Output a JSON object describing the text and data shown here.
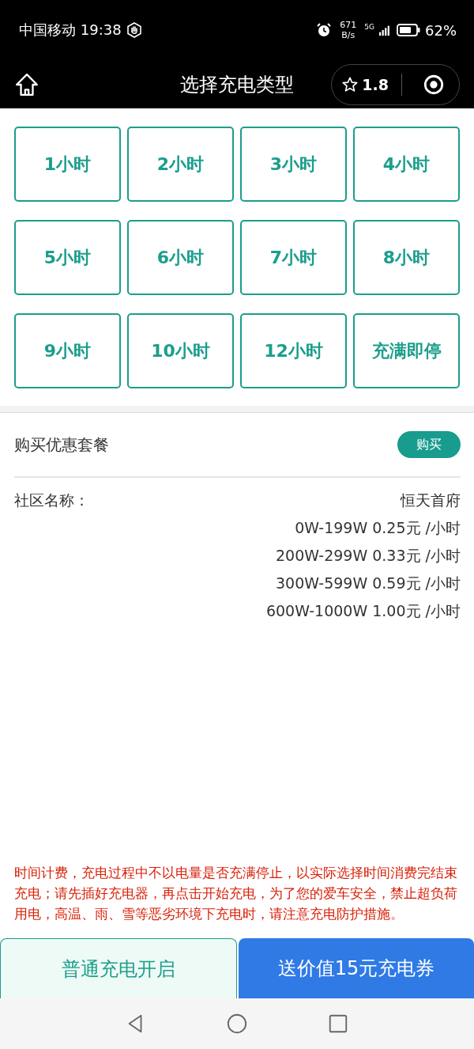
{
  "status_bar": {
    "carrier_time": "中国移动 19:38",
    "speed_value": "671",
    "speed_unit": "B/s",
    "network": "5G",
    "battery": "62%"
  },
  "header": {
    "title": "选择充电类型",
    "rating": "1.8"
  },
  "options": [
    {
      "label": "1小时",
      "selected": false
    },
    {
      "label": "2小时",
      "selected": false
    },
    {
      "label": "3小时",
      "selected": false
    },
    {
      "label": "4小时",
      "selected": false
    },
    {
      "label": "5小时",
      "selected": false
    },
    {
      "label": "6小时",
      "selected": false
    },
    {
      "label": "7小时",
      "selected": false
    },
    {
      "label": "8小时",
      "selected": false
    },
    {
      "label": "9小时",
      "selected": false
    },
    {
      "label": "10小时",
      "selected": false
    },
    {
      "label": "12小时",
      "selected": false
    },
    {
      "label": "充满即停",
      "selected": false
    }
  ],
  "package": {
    "label": "购买优惠套餐",
    "button": "购买"
  },
  "community": {
    "label": "社区名称：",
    "name": "恒天首府",
    "prices": [
      "0W-199W 0.25元 /小时",
      "200W-299W 0.33元 /小时",
      "300W-599W 0.59元 /小时",
      "600W-1000W 1.00元 /小时"
    ]
  },
  "notice": "时间计费，充电过程中不以电量是否充满停止，以实际选择时间消费完结束充电；请先插好充电器，再点击开始充电，为了您的爱车安全，禁止超负荷用电，高温、雨、雪等恶劣环境下充电时，请注意充电防护措施。",
  "actions": [
    {
      "label": "普通充电开启",
      "kind": "secondary"
    },
    {
      "label": "送价值15元充电券",
      "kind": "primary"
    }
  ]
}
